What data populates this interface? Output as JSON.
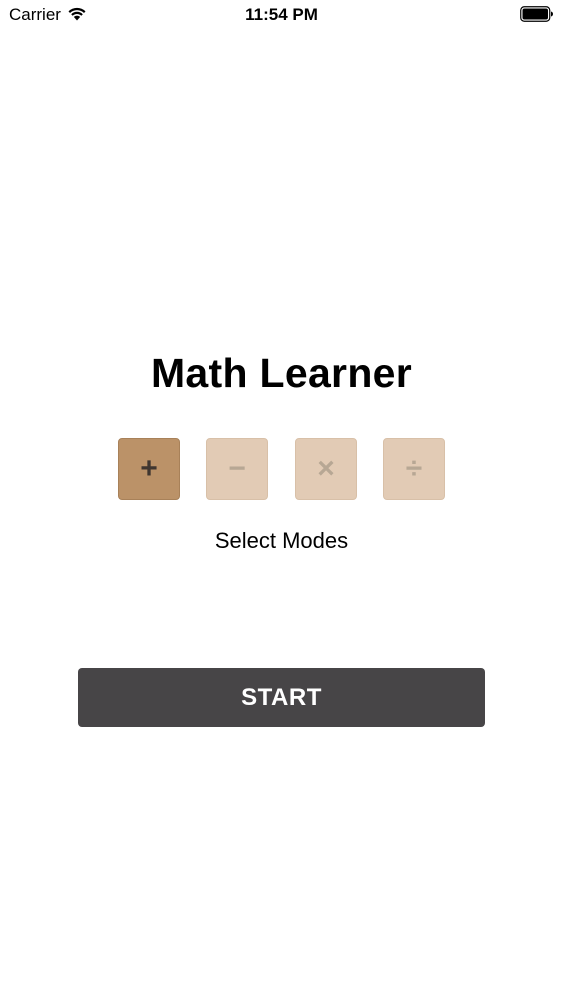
{
  "status_bar": {
    "carrier": "Carrier",
    "time": "11:54 PM",
    "wifi_icon": "wifi-icon",
    "battery_icon": "battery-full-icon"
  },
  "app": {
    "title": "Math Learner"
  },
  "modes": {
    "items": [
      {
        "symbol": "+",
        "name": "addition",
        "selected": true
      },
      {
        "symbol": "−",
        "name": "subtraction",
        "selected": false
      },
      {
        "symbol": "×",
        "name": "multiplication",
        "selected": false
      },
      {
        "symbol": "÷",
        "name": "division",
        "selected": false
      }
    ],
    "label": "Select Modes"
  },
  "start_button": {
    "label": "START"
  },
  "colors": {
    "mode_selected_bg": "#bb9268",
    "mode_unselected_bg": "#e2cbb5",
    "start_button_bg": "#474547",
    "background": "#ffffff"
  }
}
